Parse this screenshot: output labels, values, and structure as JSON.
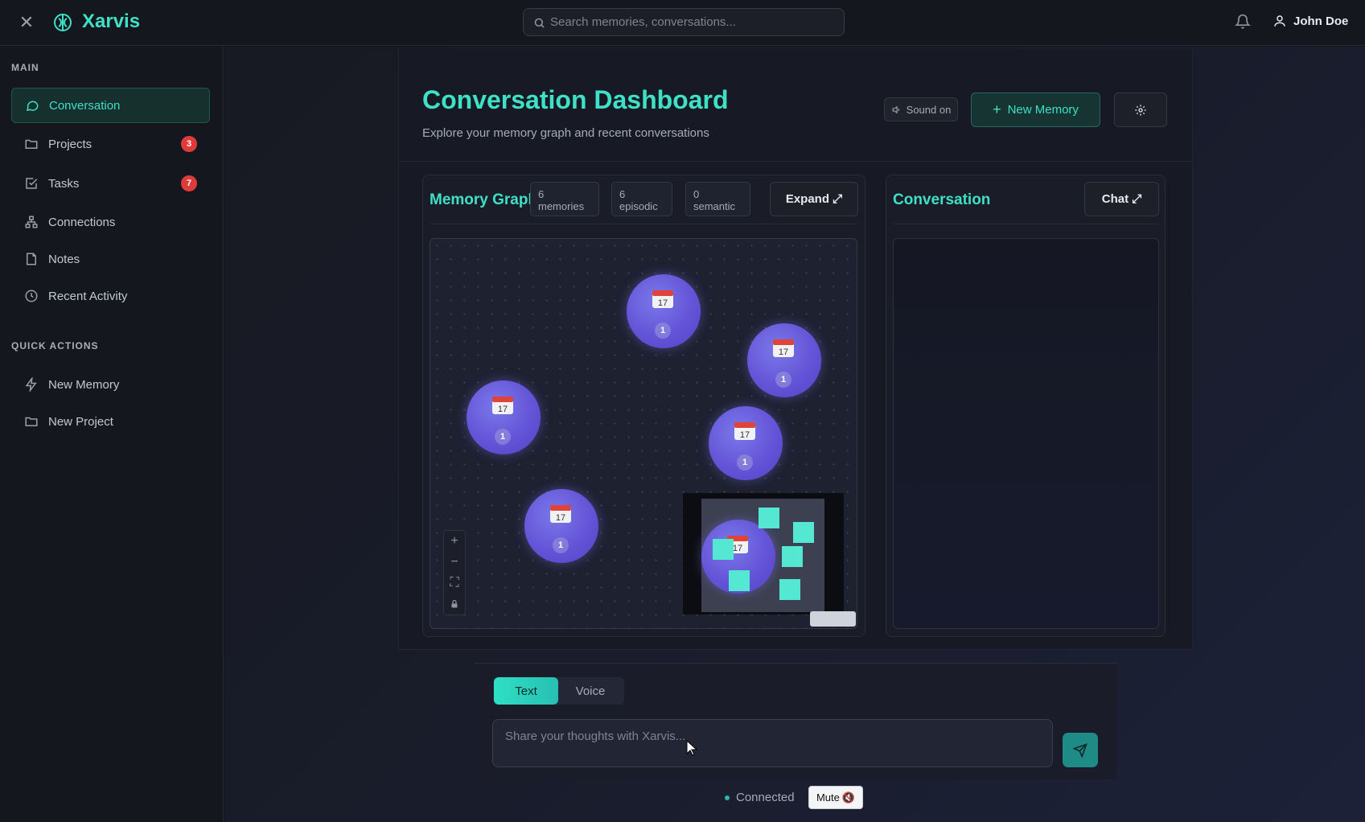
{
  "app": {
    "name": "Xarvis"
  },
  "search": {
    "placeholder": "Search memories, conversations..."
  },
  "user": {
    "name": "John Doe"
  },
  "sidebar": {
    "main_title": "MAIN",
    "items": [
      {
        "label": "Conversation",
        "icon": "chat-bubble-icon",
        "active": true
      },
      {
        "label": "Projects",
        "icon": "folder-icon",
        "badge": "3"
      },
      {
        "label": "Tasks",
        "icon": "checkbox-icon",
        "badge": "7"
      },
      {
        "label": "Connections",
        "icon": "network-icon"
      },
      {
        "label": "Notes",
        "icon": "file-icon"
      },
      {
        "label": "Recent Activity",
        "icon": "clock-icon"
      }
    ],
    "quick_title": "QUICK ACTIONS",
    "quick_items": [
      {
        "label": "New Memory",
        "icon": "lightning-icon"
      },
      {
        "label": "New Project",
        "icon": "folder-icon"
      }
    ]
  },
  "header": {
    "title": "Conversation Dashboard",
    "subtitle": "Explore your memory graph and recent conversations",
    "sound_label": "Sound on",
    "new_memory_label": "New Memory"
  },
  "memory_graph": {
    "title": "Memory Graph",
    "stats": {
      "memories": "6 memories",
      "episodic": "6 episodic",
      "semantic": "0 semantic"
    },
    "expand_label": "Expand ⤢",
    "nodes": [
      {
        "icon": "calendar-icon",
        "count": "1"
      },
      {
        "icon": "calendar-icon",
        "count": "1"
      },
      {
        "icon": "calendar-icon",
        "count": "1"
      },
      {
        "icon": "calendar-icon",
        "count": "1"
      },
      {
        "icon": "calendar-icon",
        "count": "1"
      },
      {
        "icon": "calendar-icon",
        "count": "1"
      }
    ]
  },
  "conversation": {
    "title": "Conversation",
    "chat_label": "Chat ⤢"
  },
  "composer": {
    "tabs": [
      "Text",
      "Voice"
    ],
    "active_tab": "Text",
    "placeholder": "Share your thoughts with Xarvis...",
    "status": "Connected",
    "mute_label": "Mute"
  },
  "colors": {
    "accent": "#3ee0c6",
    "node": "#6454d8",
    "badge": "#e03b3b"
  }
}
